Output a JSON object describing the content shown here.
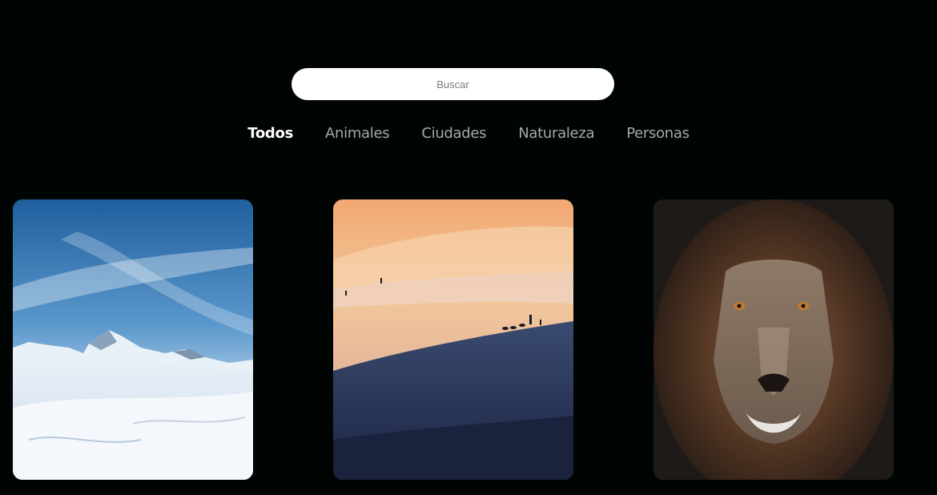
{
  "search": {
    "placeholder": "Buscar",
    "value": ""
  },
  "filters": [
    {
      "label": "Todos",
      "active": true
    },
    {
      "label": "Animales",
      "active": false
    },
    {
      "label": "Ciudades",
      "active": false
    },
    {
      "label": "Naturaleza",
      "active": false
    },
    {
      "label": "Personas",
      "active": false
    }
  ],
  "gallery": [
    {
      "subject": "snowy-mountain",
      "kind": "naturaleza"
    },
    {
      "subject": "desert-dunes-sunset",
      "kind": "naturaleza"
    },
    {
      "subject": "lion-portrait",
      "kind": "animales"
    }
  ],
  "colors": {
    "background": "#000403",
    "active_filter": "#ffffff",
    "inactive_filter": "#a8a8a8",
    "search_bg": "#ffffff"
  }
}
